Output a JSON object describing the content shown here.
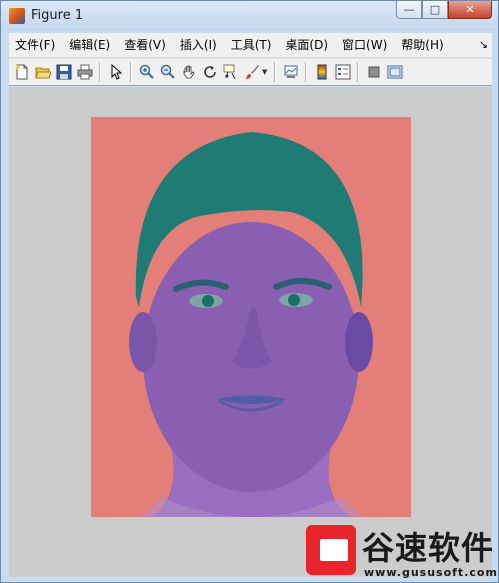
{
  "window": {
    "title": "Figure 1",
    "controls": {
      "minimize": "—",
      "maximize": "□",
      "close": "✕"
    }
  },
  "menu": {
    "items": [
      "文件(F)",
      "编辑(E)",
      "查看(V)",
      "插入(I)",
      "工具(T)",
      "桌面(D)",
      "窗口(W)",
      "帮助(H)"
    ],
    "overflow": "↘"
  },
  "toolbar": {
    "buttons": [
      "new-figure-icon",
      "open-file-icon",
      "save-icon",
      "print-icon",
      "pointer-icon",
      "zoom-in-icon",
      "zoom-out-icon",
      "pan-icon",
      "rotate-3d-icon",
      "data-cursor-icon",
      "brush-icon",
      "link-plot-icon",
      "colorbar-icon",
      "legend-icon",
      "hide-plot-tools-icon",
      "show-plot-tools-icon"
    ]
  },
  "figure": {
    "image": "face-portrait",
    "background_color": "#cccccc",
    "image_background_color": "#e37e78",
    "hair_color": "#1f7b74",
    "skin_color": "#8a5fb2"
  },
  "watermark": {
    "name": "谷速软件",
    "url": "www.gususoft.com",
    "brand_color": "#e8242d"
  }
}
